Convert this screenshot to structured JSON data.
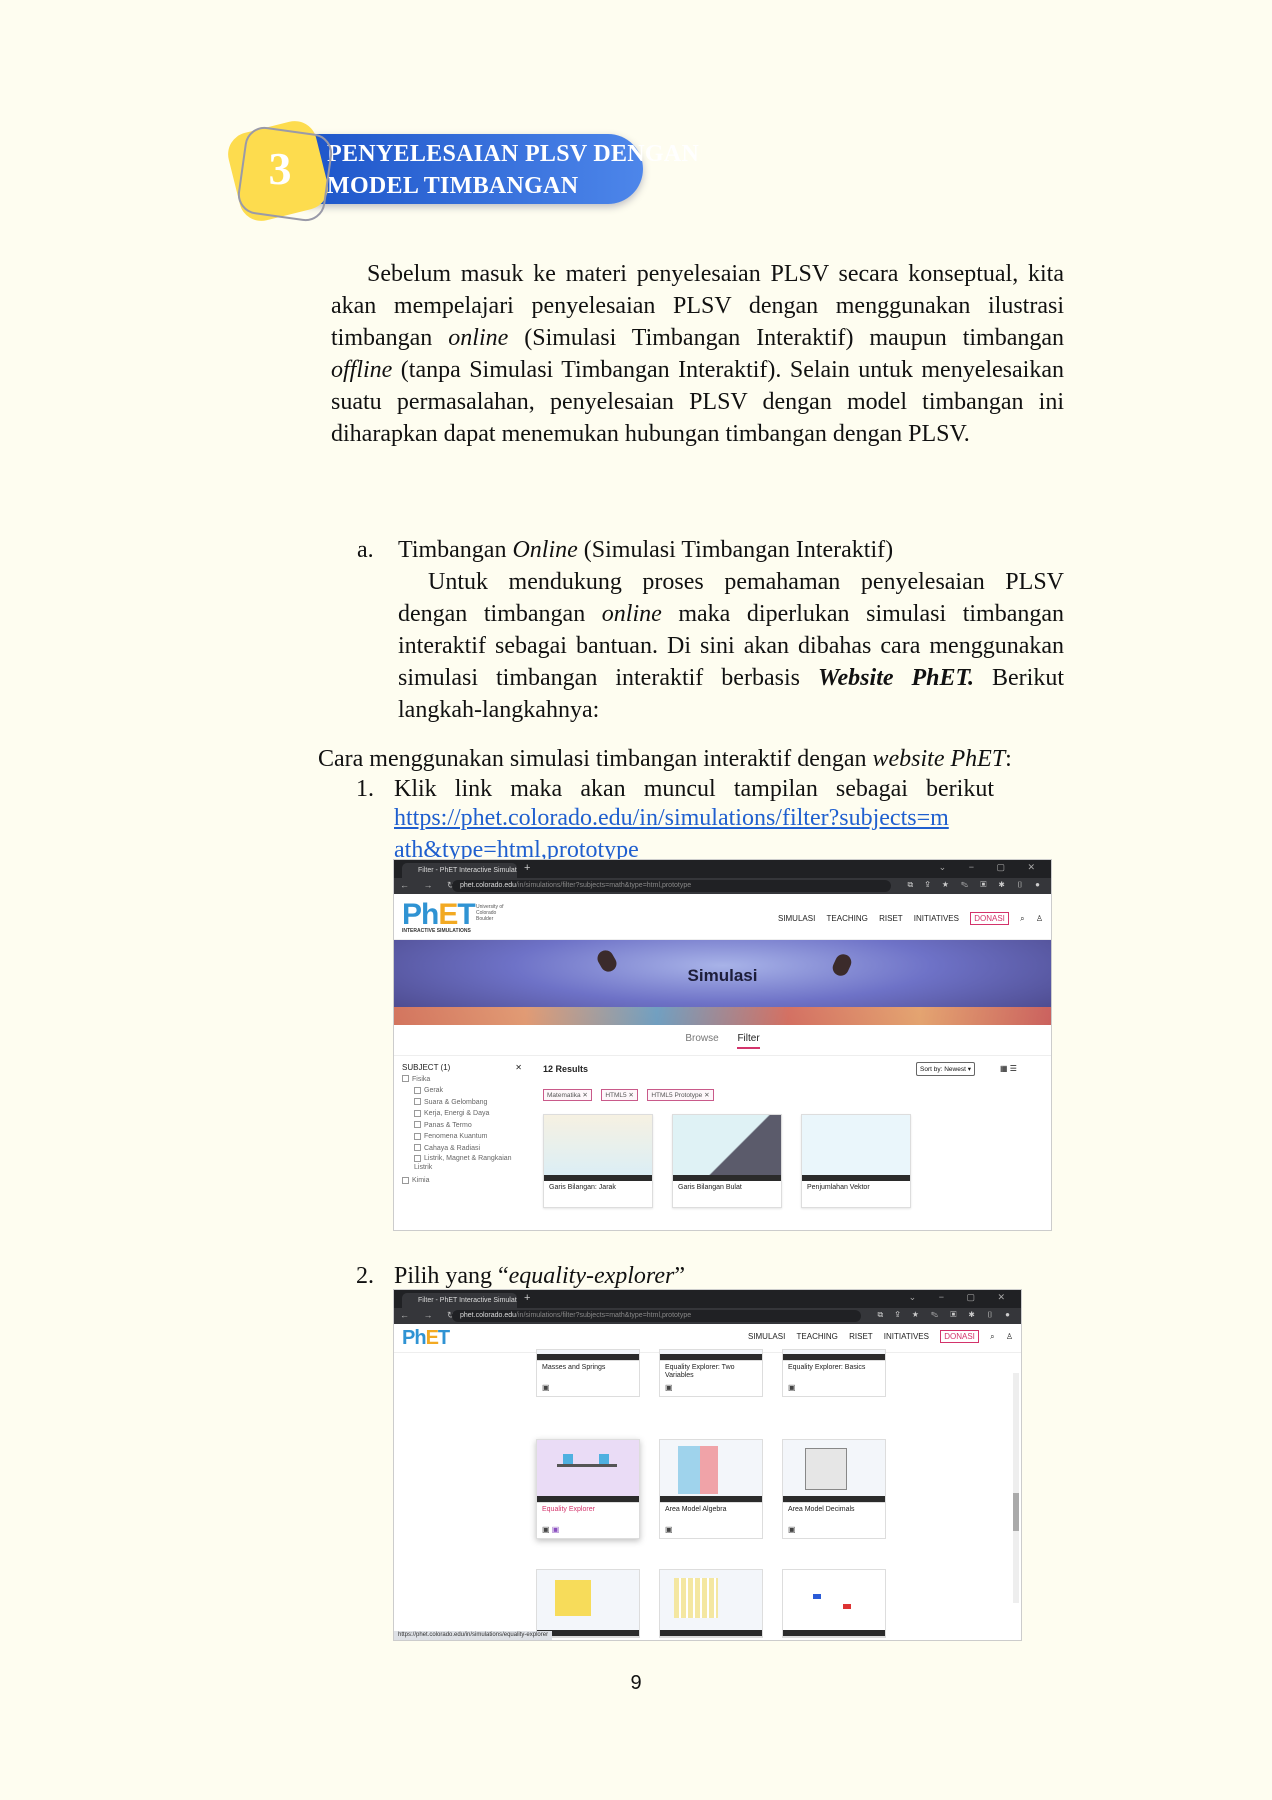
{
  "header": {
    "number": "3",
    "title_line1": "PENYELESAIAN PLSV DENGAN",
    "title_line2": "MODEL TIMBANGAN"
  },
  "intro": {
    "p1": "Sebelum masuk ke materi penyelesaian PLSV secara konseptual, kita akan mempelajari penyelesaian PLSV dengan menggunakan ilustrasi timbangan",
    "p1_em1": "online",
    "p1b": "(Simulasi Timbangan Interaktif) maupun timbangan",
    "p1_em2": "offline",
    "p1c": "(tanpa Simulasi Timbangan Interaktif). Selain untuk menyelesaikan suatu permasalahan, penyelesaian PLSV dengan model timbangan ini diharapkan dapat menemukan hubungan timbangan dengan PLSV."
  },
  "section_a": {
    "marker": "a.",
    "title_pre": "Timbangan",
    "title_em": "Online",
    "title_post": "(Simulasi Timbangan Interaktif)",
    "body1": "Untuk mendukung proses pemahaman penyelesaian PLSV dengan timbangan",
    "body_em": "online",
    "body2": "maka diperlukan simulasi timbangan interaktif sebagai bantuan. Di sini akan dibahas cara menggunakan simulasi timbangan interaktif berbasis",
    "body_bold": "Website PhET.",
    "body3": "Berikut langkah-langkahnya:"
  },
  "steps_intro": {
    "pre": "Cara menggunakan simulasi timbangan interaktif dengan",
    "em": "website PhET",
    "post": ":"
  },
  "step1": {
    "num": "1.",
    "text": "Klik link maka akan muncul tampilan sebagai berikut",
    "link_line1": "https://phet.colorado.edu/in/simulations/filter?subjects=m",
    "link_line2": "ath&type=html,prototype"
  },
  "step2": {
    "num": "2.",
    "pre": "Pilih yang “",
    "em": "equality-explorer",
    "post": "”"
  },
  "browser1": {
    "tab": "Filter - PhET Interactive Simulati",
    "url_host": "phet.colorado.edu",
    "url_rest": "/in/simulations/filter?subjects=math&type=html,prototype",
    "logo_sub": "INTERACTIVE SIMULATIONS",
    "cu_text": "University of Colorado Boulder",
    "nav": [
      "SIMULASI",
      "TEACHING",
      "RISET",
      "INITIATIVES",
      "DONASI"
    ],
    "banner_title": "Simulasi",
    "tabs": [
      "Browse",
      "Filter"
    ],
    "subject_header": "SUBJECT (1)",
    "subjects": [
      "Fisika",
      "Gerak",
      "Suara & Gelombang",
      "Kerja, Energi & Daya",
      "Panas & Termo",
      "Fenomena Kuantum",
      "Cahaya & Radiasi",
      "Listrik, Magnet & Rangkaian Listrik",
      "Kimia"
    ],
    "results": "12 Results",
    "chips": [
      "Matematika ✕",
      "HTML5 ✕",
      "HTML5 Prototype ✕"
    ],
    "sort": "Sort by: Newest",
    "cards": [
      "Garis Bilangan: Jarak",
      "Garis Bilangan Bulat",
      "Penjumlahan Vektor"
    ]
  },
  "browser2": {
    "tab": "Filter - PhET Interactive Simulati",
    "url_host": "phet.colorado.edu",
    "url_rest": "/in/simulations/filter?subjects=math&type=html,prototype",
    "nav": [
      "SIMULASI",
      "TEACHING",
      "RISET",
      "INITIATIVES",
      "DONASI"
    ],
    "cards_row1": [
      "Masses and Springs",
      "Equality Explorer: Two Variables",
      "Equality Explorer: Basics"
    ],
    "cards_row2": [
      "Equality Explorer",
      "Area Model Algebra",
      "Area Model Decimals"
    ],
    "status_url": "https://phet.colorado.edu/in/simulations/equality-explorer"
  },
  "page_number": "9",
  "colors": {
    "accent_blue": "#1d55c9",
    "badge_yellow": "#fddc4e",
    "phet_pink": "#d3336b"
  }
}
